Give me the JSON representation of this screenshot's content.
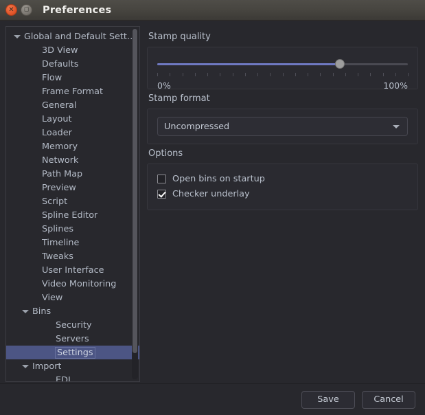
{
  "window": {
    "title": "Preferences",
    "close_icon": "close-icon",
    "maximize_icon": "maximize-icon",
    "close_glyph": "✕",
    "maximize_glyph": "◻"
  },
  "sidebar": {
    "items": [
      {
        "label": "Global and Default Settings",
        "level": 0,
        "expandable": true,
        "expanded": true,
        "selected": false
      },
      {
        "label": "3D View",
        "level": 1,
        "expandable": false,
        "expanded": false,
        "selected": false
      },
      {
        "label": "Defaults",
        "level": 1,
        "expandable": false,
        "expanded": false,
        "selected": false
      },
      {
        "label": "Flow",
        "level": 1,
        "expandable": false,
        "expanded": false,
        "selected": false
      },
      {
        "label": "Frame Format",
        "level": 1,
        "expandable": false,
        "expanded": false,
        "selected": false
      },
      {
        "label": "General",
        "level": 1,
        "expandable": false,
        "expanded": false,
        "selected": false
      },
      {
        "label": "Layout",
        "level": 1,
        "expandable": false,
        "expanded": false,
        "selected": false
      },
      {
        "label": "Loader",
        "level": 1,
        "expandable": false,
        "expanded": false,
        "selected": false
      },
      {
        "label": "Memory",
        "level": 1,
        "expandable": false,
        "expanded": false,
        "selected": false
      },
      {
        "label": "Network",
        "level": 1,
        "expandable": false,
        "expanded": false,
        "selected": false
      },
      {
        "label": "Path Map",
        "level": 1,
        "expandable": false,
        "expanded": false,
        "selected": false
      },
      {
        "label": "Preview",
        "level": 1,
        "expandable": false,
        "expanded": false,
        "selected": false
      },
      {
        "label": "Script",
        "level": 1,
        "expandable": false,
        "expanded": false,
        "selected": false
      },
      {
        "label": "Spline Editor",
        "level": 1,
        "expandable": false,
        "expanded": false,
        "selected": false
      },
      {
        "label": "Splines",
        "level": 1,
        "expandable": false,
        "expanded": false,
        "selected": false
      },
      {
        "label": "Timeline",
        "level": 1,
        "expandable": false,
        "expanded": false,
        "selected": false
      },
      {
        "label": "Tweaks",
        "level": 1,
        "expandable": false,
        "expanded": false,
        "selected": false
      },
      {
        "label": "User Interface",
        "level": 1,
        "expandable": false,
        "expanded": false,
        "selected": false
      },
      {
        "label": "Video Monitoring",
        "level": 1,
        "expandable": false,
        "expanded": false,
        "selected": false
      },
      {
        "label": "View",
        "level": 1,
        "expandable": false,
        "expanded": false,
        "selected": false
      },
      {
        "label": "Bins",
        "level": 1,
        "expandable": true,
        "expanded": true,
        "selected": false
      },
      {
        "label": "Security",
        "level": 2,
        "expandable": false,
        "expanded": false,
        "selected": false
      },
      {
        "label": "Servers",
        "level": 2,
        "expandable": false,
        "expanded": false,
        "selected": false
      },
      {
        "label": "Settings",
        "level": 2,
        "expandable": false,
        "expanded": false,
        "selected": true
      },
      {
        "label": "Import",
        "level": 1,
        "expandable": true,
        "expanded": true,
        "selected": false
      },
      {
        "label": "EDL",
        "level": 2,
        "expandable": false,
        "expanded": false,
        "selected": false
      }
    ],
    "scrollbar": {
      "name": "sidebar-scrollbar"
    }
  },
  "main": {
    "stamp_quality": {
      "title": "Stamp quality",
      "value_percent": 73,
      "min_label": "0%",
      "max_label": "100%",
      "tick_count": 21
    },
    "stamp_format": {
      "title": "Stamp format",
      "selected": "Uncompressed",
      "options": [
        "Uncompressed"
      ],
      "chevron_icon": "chevron-down-icon"
    },
    "options": {
      "title": "Options",
      "items": [
        {
          "label": "Open bins on startup",
          "checked": false
        },
        {
          "label": "Checker underlay",
          "checked": true
        }
      ]
    }
  },
  "footer": {
    "save_label": "Save",
    "cancel_label": "Cancel"
  },
  "colors": {
    "background": "#28282d",
    "titlebar": "#474540",
    "selection": "#4c5584",
    "slider_fill": "#6f79c2",
    "text": "#b9c0cc",
    "close_button": "#e2562a"
  }
}
